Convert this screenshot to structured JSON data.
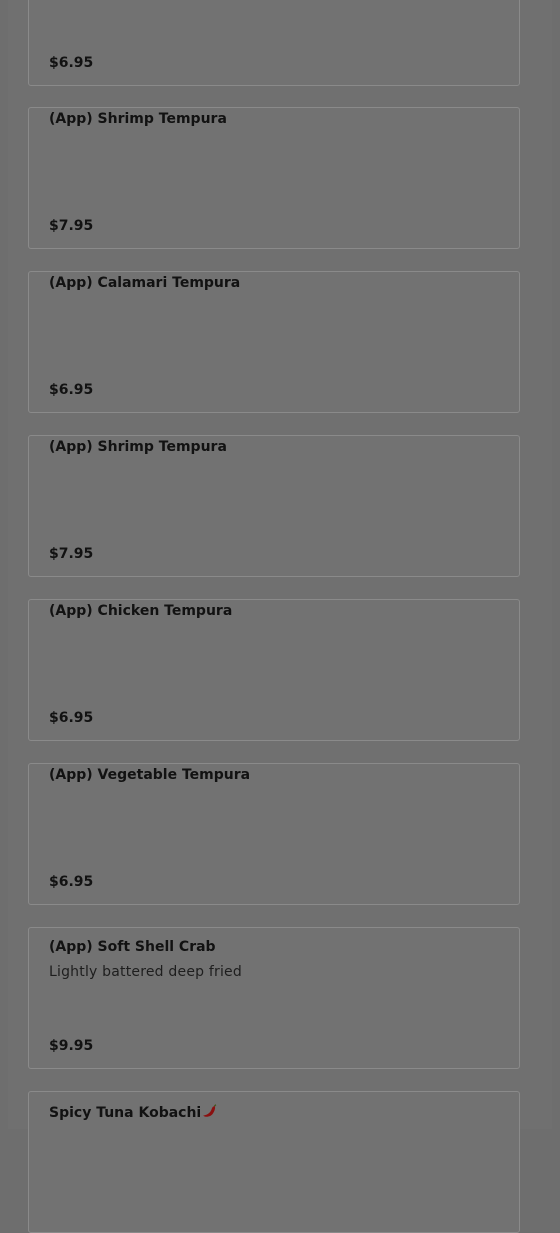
{
  "colors": {
    "overlay_background": "#707070",
    "card_border": "#8a8a8a",
    "text": "#121212",
    "pepper": "#8a1010"
  },
  "menu": {
    "items": [
      {
        "name": "",
        "description": "",
        "price": "$6.95",
        "spicy": false
      },
      {
        "name": "(App) Shrimp Tempura",
        "description": "",
        "price": "$7.95",
        "spicy": false
      },
      {
        "name": "(App) Calamari Tempura",
        "description": "",
        "price": "$6.95",
        "spicy": false
      },
      {
        "name": "(App) Shrimp Tempura",
        "description": "",
        "price": "$7.95",
        "spicy": false
      },
      {
        "name": "(App) Chicken Tempura",
        "description": "",
        "price": "$6.95",
        "spicy": false
      },
      {
        "name": "(App) Vegetable Tempura",
        "description": "",
        "price": "$6.95",
        "spicy": false
      },
      {
        "name": "(App) Soft Shell Crab",
        "description": "Lightly battered deep fried",
        "price": "$9.95",
        "spicy": false
      },
      {
        "name": "Spicy Tuna Kobachi",
        "description": "",
        "price": "",
        "spicy": true
      }
    ]
  }
}
